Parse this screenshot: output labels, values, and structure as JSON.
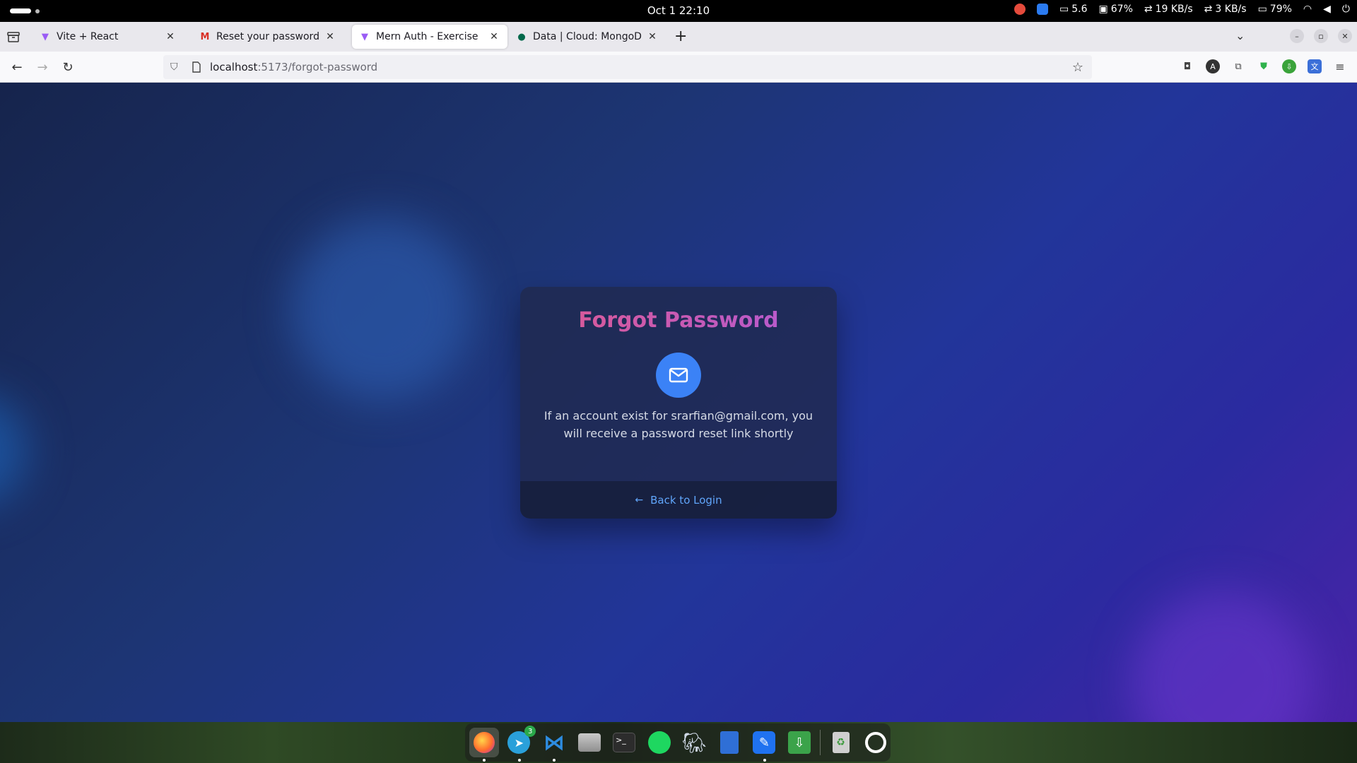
{
  "system_bar": {
    "clock": "Oct 1  22:10",
    "indicators": {
      "display": "5.6",
      "cpu": "67%",
      "net_down": "19 KB/s",
      "net_up": "3 KB/s",
      "battery": "79%"
    }
  },
  "browser": {
    "tabs": [
      {
        "title": "Vite + React",
        "favicon": "vite-icon"
      },
      {
        "title": "Reset your password - sra",
        "favicon": "gmail-icon"
      },
      {
        "title": "Mern Auth - Exercise",
        "favicon": "vite-icon",
        "active": true
      },
      {
        "title": "Data | Cloud: MongoDB C",
        "favicon": "mongodb-icon"
      }
    ],
    "url_host": "localhost",
    "url_path": ":5173/forgot-password"
  },
  "card": {
    "title": "Forgot Password",
    "message": "If an account exist for srarfian@gmail.com, you will receive a password reset link shortly",
    "back_link": "Back to Login"
  },
  "dock": {
    "apps": [
      "firefox",
      "telegram",
      "vscode",
      "files",
      "terminal",
      "spotify",
      "postgresql",
      "docs",
      "feather",
      "downloader",
      "trash",
      "ubuntu"
    ],
    "telegram_badge": "3"
  },
  "colors": {
    "title_gradient_start": "#e05a8f",
    "title_gradient_end": "#b05ad8",
    "mail_circle": "#3b82f6",
    "link": "#60a5fa"
  }
}
